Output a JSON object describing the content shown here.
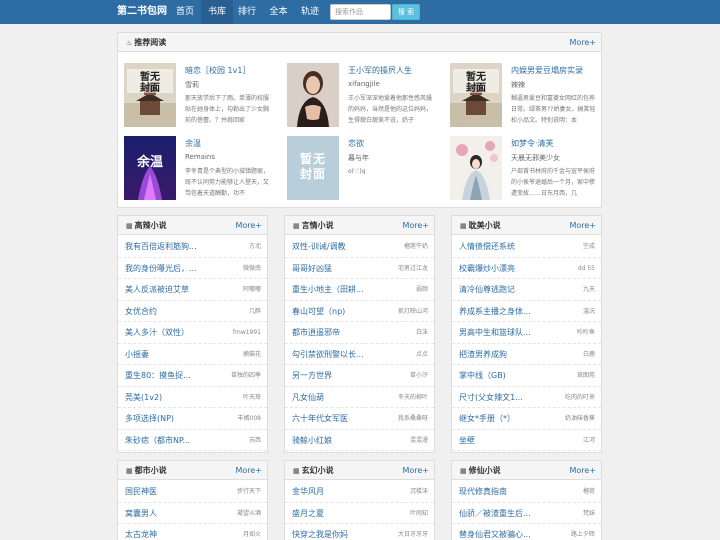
{
  "nav": {
    "brand": "第二书包网",
    "items": [
      "首页",
      "书库",
      "排行",
      "全本",
      "轨迹"
    ],
    "search_placeholder": "搜索作品",
    "search_button": "搜 索"
  },
  "featured": {
    "title": "推荐阅读",
    "more": "More+",
    "books": [
      {
        "title": "暗恋［校园 1v1］",
        "author": "雪莉",
        "desc": "那天放学后下了雨。单薄的校服贴在她身体上，勾勒出了少女胸前的蓓蕾。？并肩回家"
      },
      {
        "title": "王小军的操屄人生",
        "author": "xifangjile",
        "desc": "王小军深深地爱着他那性感风骚的妈妈，当然是他的这位妈妈，生得貌白貌美不说，奶子"
      },
      {
        "title": "内娱男爱豆塌房实录",
        "author": "辣辣",
        "desc": "糊逼男爱豆和富婆女网红的包养日常。绿茶男??娇妻女。搞笑轻松小品文。特别说明：本"
      },
      {
        "title": "余温",
        "author": "Remains",
        "desc": "李冬青是个典型的小城镇题家，既不认同努力能够让人登天，又笃信着天道酬勤，功不"
      },
      {
        "title": "恋欲",
        "author": "暮与年",
        "desc": "o(♡)q"
      },
      {
        "title": "如梦令·清芙",
        "author": "天晨无邪美少女",
        "desc": "户部首书林府的千金与宣平侯府的小侯爷退婚后一个月，家中惨遭变故……日东月西，几"
      }
    ]
  },
  "cover_text": "暂无封面",
  "lists": [
    {
      "title": "高辣小说",
      "more": "More+",
      "items": [
        {
          "title": "我有百倍返利筋狗...",
          "author": "方北"
        },
        {
          "title": "我的身份曝光后，...",
          "author": "微微南"
        },
        {
          "title": "美人反派被迫艾草",
          "author": "阿嘟嘟"
        },
        {
          "title": "女优合约",
          "author": "几醉"
        },
        {
          "title": "美人多汁（双性）",
          "author": "fmw1991"
        },
        {
          "title": "小摇妻",
          "author": "摘猫花"
        },
        {
          "title": "重生80：摸鱼捉...",
          "author": "苗独的四季"
        },
        {
          "title": "莞美(1v2)",
          "author": "叶天荩"
        },
        {
          "title": "多项选择(NP)",
          "author": "丰嫣008"
        },
        {
          "title": "朱砂痣（都市NP...",
          "author": "苏西"
        }
      ]
    },
    {
      "title": "言情小说",
      "more": "More+",
      "items": [
        {
          "title": "双性-训诫/调教",
          "author": "榴莲牛奶"
        },
        {
          "title": "哥哥好凶猛",
          "author": "宅男过江龙"
        },
        {
          "title": "重生小地主（田耕...",
          "author": "弱颜"
        },
        {
          "title": "春山可望（np)",
          "author": "抓灯映山河"
        },
        {
          "title": "都市逍遥邪帝",
          "author": "白沫"
        },
        {
          "title": "勾引禁欲刑警以长...",
          "author": "点点"
        },
        {
          "title": "另一方世界",
          "author": "苗小汐"
        },
        {
          "title": "凡女仙葫",
          "author": "冬天的柳叶"
        },
        {
          "title": "六十年代女军医",
          "author": "我系桑桑呀"
        },
        {
          "title": "骑鲸小红娘",
          "author": "混混漫"
        }
      ]
    },
    {
      "title": "耽美小说",
      "more": "More+",
      "items": [
        {
          "title": "人情债偿还系统",
          "author": "空成"
        },
        {
          "title": "校霸爆炒小漂亮",
          "author": "dd 55"
        },
        {
          "title": "清冷仙尊逃跑记",
          "author": "九天"
        },
        {
          "title": "养成系主播之身体...",
          "author": "温沅"
        },
        {
          "title": "男高中生和篮球队...",
          "author": "吵吵鱼"
        },
        {
          "title": "把渣男养成狗",
          "author": "白鹿"
        },
        {
          "title": "掌中线（GB)",
          "author": "琉图苑"
        },
        {
          "title": "尺寸(父女辣文1...",
          "author": "吃肉的叮来"
        },
        {
          "title": "继女*手册（*）",
          "author": "奶油味香蕉"
        },
        {
          "title": "坐壁",
          "author": "江河"
        }
      ]
    },
    {
      "title": "都市小说",
      "more": "More+",
      "items": [
        {
          "title": "国民神医",
          "author": "步行天下"
        },
        {
          "title": "窝囊男人",
          "author": "凝望斗酒"
        },
        {
          "title": "太古龙神",
          "author": "月如火"
        }
      ]
    },
    {
      "title": "玄幻小说",
      "more": "More+",
      "items": [
        {
          "title": "金华风月",
          "author": "沉楼沫"
        },
        {
          "title": "盛月之夏",
          "author": "叶闹知"
        },
        {
          "title": "快穿之我是你妈",
          "author": "大日牙牙牙"
        }
      ]
    },
    {
      "title": "修仙小说",
      "more": "More+",
      "items": [
        {
          "title": "现代修真指南",
          "author": "榴荷"
        },
        {
          "title": "仙骄／被渣重生后...",
          "author": "梵妹"
        },
        {
          "title": "替身仙君又被骗心...",
          "author": "路上夕晖"
        }
      ]
    }
  ]
}
